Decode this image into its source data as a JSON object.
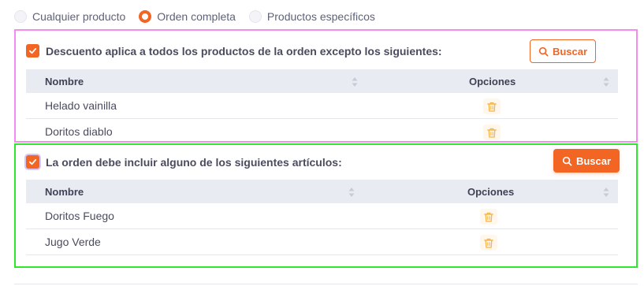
{
  "scope_options": {
    "items": [
      {
        "label": "Cualquier producto",
        "selected": false
      },
      {
        "label": "Orden completa",
        "selected": true
      },
      {
        "label": "Productos específicos",
        "selected": false
      }
    ]
  },
  "exclusion_section": {
    "checked": true,
    "title": "Descuento aplica a todos los productos de la orden excepto los siguientes:",
    "search_button": "Buscar",
    "table": {
      "columns": [
        "Nombre",
        "Opciones"
      ],
      "rows": [
        {
          "name": "Helado vainilla"
        },
        {
          "name": "Doritos diablo"
        }
      ]
    }
  },
  "requirement_section": {
    "checked": true,
    "title": "La orden debe incluir alguno de los siguientes artículos:",
    "search_button": "Buscar",
    "table": {
      "columns": [
        "Nombre",
        "Opciones"
      ],
      "rows": [
        {
          "name": "Doritos Fuego"
        },
        {
          "name": "Jugo Verde"
        }
      ]
    }
  },
  "colors": {
    "accent": "#f26522",
    "trash_icon": "#f5b547",
    "header_bg": "#e9ebf3",
    "highlight_pink": "#f58af0",
    "highlight_green": "#2ee82e"
  },
  "icons": [
    "check-icon",
    "search-icon",
    "sort-icon",
    "trash-icon"
  ]
}
